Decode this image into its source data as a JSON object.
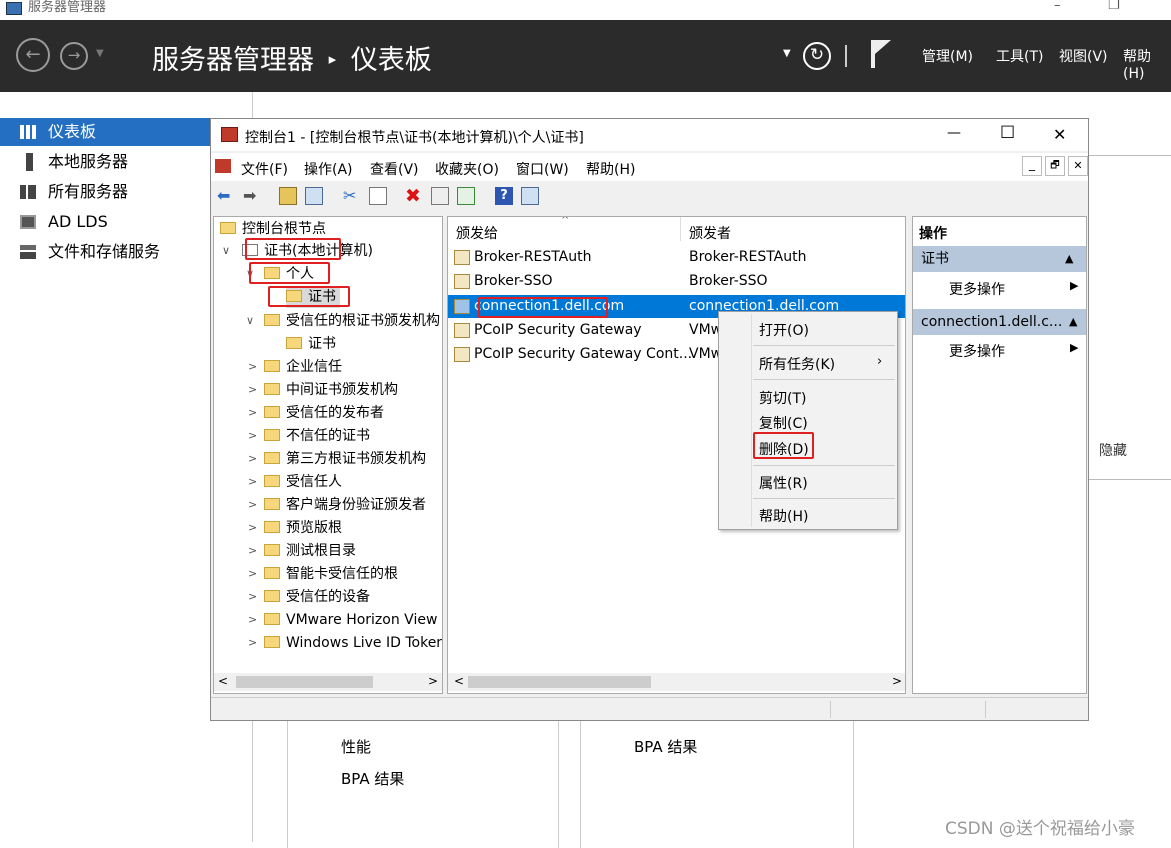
{
  "window": {
    "title": "服务器管理器",
    "controls": {
      "minimize": "–",
      "maximize": "❐"
    }
  },
  "topbar": {
    "breadcrumb_app": "服务器管理器",
    "breadcrumb_sep": "▸",
    "breadcrumb_page": "仪表板",
    "menus": [
      "管理(M)",
      "工具(T)",
      "视图(V)",
      "帮助(H)"
    ]
  },
  "leftnav": {
    "items": [
      {
        "label": "仪表板",
        "icon": "dashboard-icon",
        "selected": true
      },
      {
        "label": "本地服务器",
        "icon": "server-icon"
      },
      {
        "label": "所有服务器",
        "icon": "servers-icon"
      },
      {
        "label": "AD LDS",
        "icon": "ad-lds-icon"
      },
      {
        "label": "文件和存储服务",
        "icon": "storage-icon"
      }
    ]
  },
  "background": {
    "hide_label": "隐藏",
    "tile1": {
      "items": [
        "性能",
        "BPA 结果"
      ]
    },
    "tile2": {
      "items": [
        "BPA 结果"
      ]
    }
  },
  "mmc": {
    "title": "控制台1 - [控制台根节点\\证书(本地计算机)\\个人\\证书]",
    "controls": {
      "minimize": "—",
      "maximize": "☐",
      "close": "✕"
    },
    "menubar": [
      "文件(F)",
      "操作(A)",
      "查看(V)",
      "收藏夹(O)",
      "窗口(W)",
      "帮助(H)"
    ],
    "child_controls": {
      "minimize": "_",
      "restore": "🗗",
      "close": "✕"
    },
    "tree": [
      {
        "label": "控制台根节点",
        "level": 0
      },
      {
        "label": "证书(本地计算机)",
        "level": 1,
        "expanded": true
      },
      {
        "label": "个人",
        "level": 2,
        "expanded": true
      },
      {
        "label": "证书",
        "level": 3,
        "selected": true
      },
      {
        "label": "受信任的根证书颁发机构",
        "level": 2,
        "expanded": true
      },
      {
        "label": "证书",
        "level": 3
      },
      {
        "label": "企业信任",
        "level": 2
      },
      {
        "label": "中间证书颁发机构",
        "level": 2
      },
      {
        "label": "受信任的发布者",
        "level": 2
      },
      {
        "label": "不信任的证书",
        "level": 2
      },
      {
        "label": "第三方根证书颁发机构",
        "level": 2
      },
      {
        "label": "受信任人",
        "level": 2
      },
      {
        "label": "客户端身份验证颁发者",
        "level": 2
      },
      {
        "label": "预览版根",
        "level": 2
      },
      {
        "label": "测试根目录",
        "level": 2
      },
      {
        "label": "智能卡受信任的根",
        "level": 2
      },
      {
        "label": "受信任的设备",
        "level": 2
      },
      {
        "label": "VMware Horizon View",
        "level": 2
      },
      {
        "label": "Windows Live ID Token",
        "level": 2
      }
    ],
    "list": {
      "columns": [
        "颁发给",
        "颁发者"
      ],
      "rows": [
        {
          "issued_to": "Broker-RESTAuth",
          "issued_by": "Broker-RESTAuth"
        },
        {
          "issued_to": "Broker-SSO",
          "issued_by": "Broker-SSO"
        },
        {
          "issued_to": "connection1.dell.com",
          "issued_by": "connection1.dell.com",
          "selected": true
        },
        {
          "issued_to": "PCoIP Security Gateway",
          "issued_by": "VMw"
        },
        {
          "issued_to": "PCoIP Security Gateway Cont...",
          "issued_by": "VMw"
        }
      ]
    },
    "actions": {
      "header": "操作",
      "sections": [
        {
          "title": "证书",
          "items": [
            "更多操作"
          ]
        },
        {
          "title": "connection1.dell.c...",
          "items": [
            "更多操作"
          ]
        }
      ]
    },
    "context_menu": [
      "打开(O)",
      "所有任务(K)",
      "剪切(T)",
      "复制(C)",
      "删除(D)",
      "属性(R)",
      "帮助(H)"
    ]
  },
  "watermark": "CSDN @送个祝福给小豪",
  "colors": {
    "accent": "#246fc1",
    "highlight": "#0078d7",
    "annotation": "#e02020",
    "topbar": "#2b2b2b"
  }
}
